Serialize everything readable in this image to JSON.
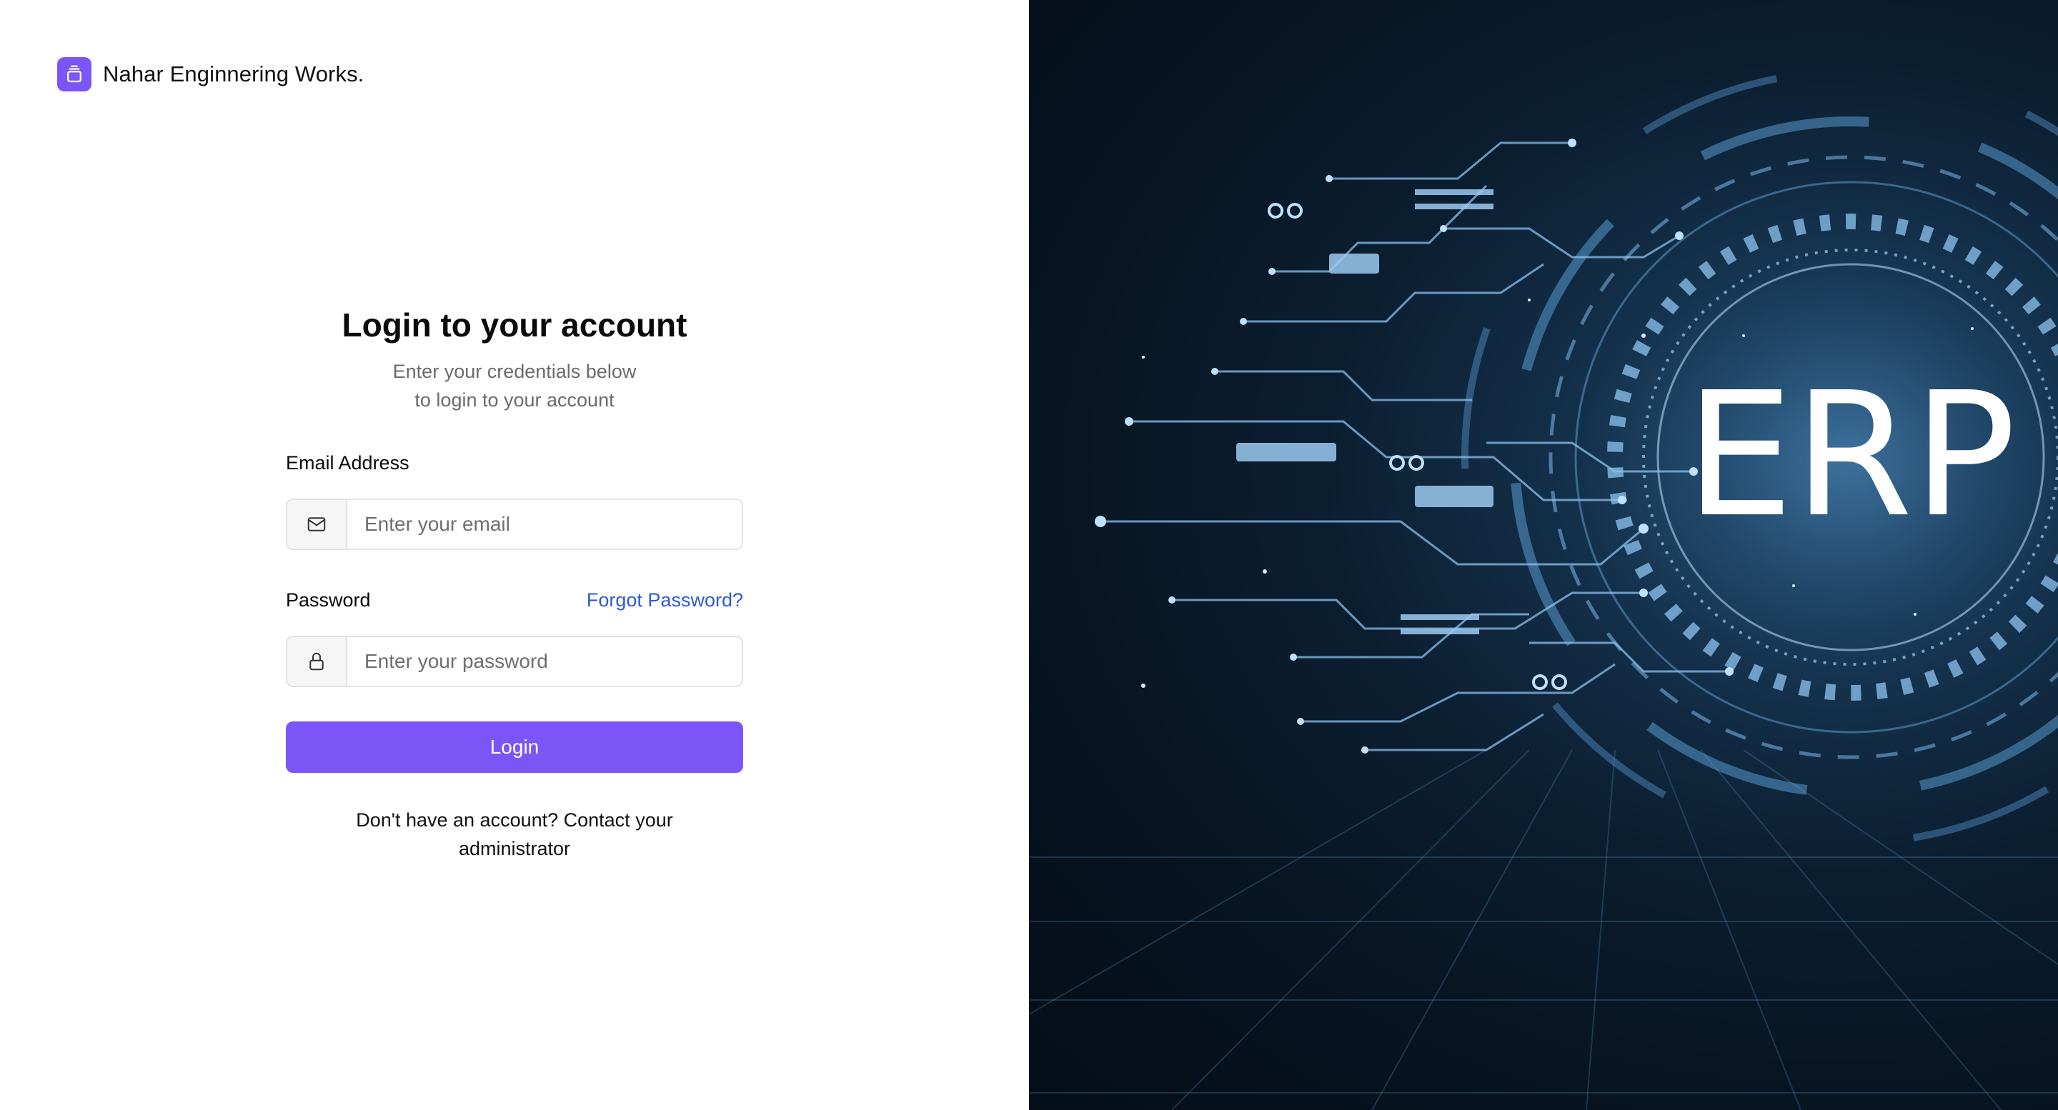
{
  "brand": {
    "name": "Nahar Enginnering Works.",
    "icon": "archive-box-icon",
    "color": "#7c55f6"
  },
  "login": {
    "title": "Login to your account",
    "subtitle_line1": "Enter your credentials below",
    "subtitle_line2": "to login to your account",
    "email": {
      "label": "Email Address",
      "placeholder": "Enter your email",
      "value": "",
      "icon": "mail-icon"
    },
    "password": {
      "label": "Password",
      "placeholder": "Enter your password",
      "value": "",
      "icon": "lock-icon",
      "forgot_link": "Forgot Password?"
    },
    "submit_label": "Login",
    "footer_text": "Don't have an account? Contact your administrator"
  },
  "hero": {
    "text": "ERP",
    "accent": "#6fb6ff"
  }
}
